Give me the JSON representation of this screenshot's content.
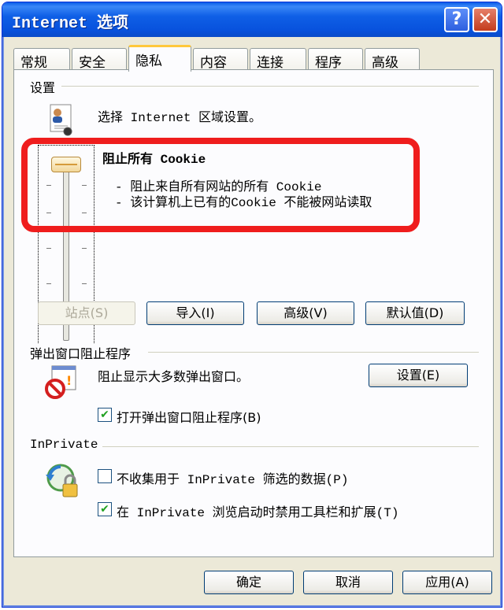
{
  "window": {
    "title": "Internet 选项",
    "help_glyph": "?",
    "close_glyph": "✕"
  },
  "tabs": [
    {
      "label": "常规",
      "active": false
    },
    {
      "label": "安全",
      "active": false
    },
    {
      "label": "隐私",
      "active": true
    },
    {
      "label": "内容",
      "active": false
    },
    {
      "label": "连接",
      "active": false
    },
    {
      "label": "程序",
      "active": false
    },
    {
      "label": "高级",
      "active": false
    }
  ],
  "settings": {
    "group_label": "设置",
    "zone_text": "选择 Internet 区域设置。",
    "level_title": "阻止所有 Cookie",
    "level_desc_1": "- 阻止来自所有网站的所有 Cookie",
    "level_desc_2": "- 该计算机上已有的Cookie 不能被网站读取",
    "slider_level": 1.0,
    "buttons": {
      "sites": "站点(S)",
      "import": "导入(I)",
      "advanced": "高级(V)",
      "default": "默认值(D)"
    }
  },
  "popup": {
    "group_label": "弹出窗口阻止程序",
    "desc": "阻止显示大多数弹出窗口。",
    "settings_button": "设置(E)",
    "checkbox_label": "打开弹出窗口阻止程序(B)",
    "checked": true
  },
  "inprivate": {
    "group_label": "InPrivate",
    "checkbox1_label": "不收集用于 InPrivate 筛选的数据(P)",
    "checkbox1_checked": false,
    "checkbox2_label": "在 InPrivate 浏览启动时禁用工具栏和扩展(T)",
    "checkbox2_checked": true
  },
  "footer": {
    "ok": "确定",
    "cancel": "取消",
    "apply": "应用(A)"
  },
  "colors": {
    "titlebar": "#0a5de8",
    "highlight": "#ef1d1d",
    "panel": "#fcfcfe"
  }
}
